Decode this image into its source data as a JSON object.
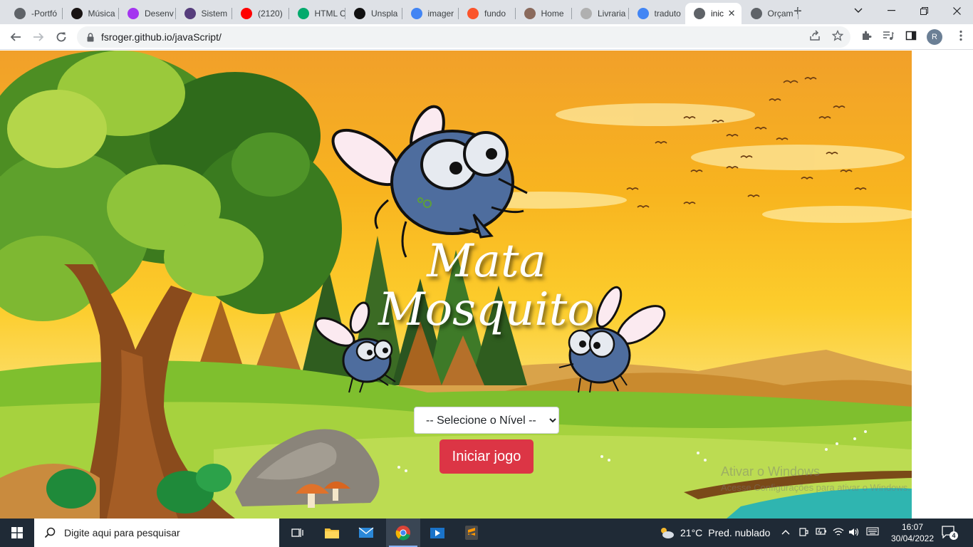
{
  "browser": {
    "tabs": [
      {
        "title": "-Portfó",
        "icon": "globe-icon",
        "color": "#5f6368"
      },
      {
        "title": "Música",
        "icon": "spotify-icon",
        "color": "#191414"
      },
      {
        "title": "Desenv",
        "icon": "udemy-icon",
        "color": "#a435f0"
      },
      {
        "title": "Sistem",
        "icon": "bootstrap-icon",
        "color": "#563d7c"
      },
      {
        "title": "(2120)",
        "icon": "youtube-icon",
        "color": "#ff0000"
      },
      {
        "title": "HTML C",
        "icon": "w3schools-icon",
        "color": "#04aa6d"
      },
      {
        "title": "Unspla",
        "icon": "unsplash-icon",
        "color": "#111111"
      },
      {
        "title": "imager",
        "icon": "google-icon",
        "color": "#4285f4"
      },
      {
        "title": "fundo",
        "icon": "brave-icon",
        "color": "#fb542b"
      },
      {
        "title": "Home",
        "icon": "home-thumb-icon",
        "color": "#8a6a5c"
      },
      {
        "title": "Livraria",
        "icon": "doc-thumb-icon",
        "color": "#b0b0b0"
      },
      {
        "title": "traduto",
        "icon": "google-icon",
        "color": "#4285f4"
      },
      {
        "title": "inic",
        "icon": "globe-icon",
        "color": "#5f6368",
        "active": true
      },
      {
        "title": "Orçam",
        "icon": "globe-icon",
        "color": "#5f6368"
      }
    ],
    "new_tab": "+",
    "url": "fsroger.github.io/javaScript/",
    "profile_initial": "R"
  },
  "page": {
    "title_line1": "Mata",
    "title_line2": "Mosquito",
    "level_select": {
      "selected": "-- Selecione o Nível --"
    },
    "start_button": "Iniciar jogo",
    "watermark_title": "Ativar o Windows",
    "watermark_text": "Acesse Configurações para ativar o Windows."
  },
  "taskbar": {
    "search_placeholder": "Digite aqui para pesquisar",
    "weather_temp": "21°C",
    "weather_text": "Pred. nublado",
    "time": "16:07",
    "date": "30/04/2022",
    "notification_count": "4"
  }
}
